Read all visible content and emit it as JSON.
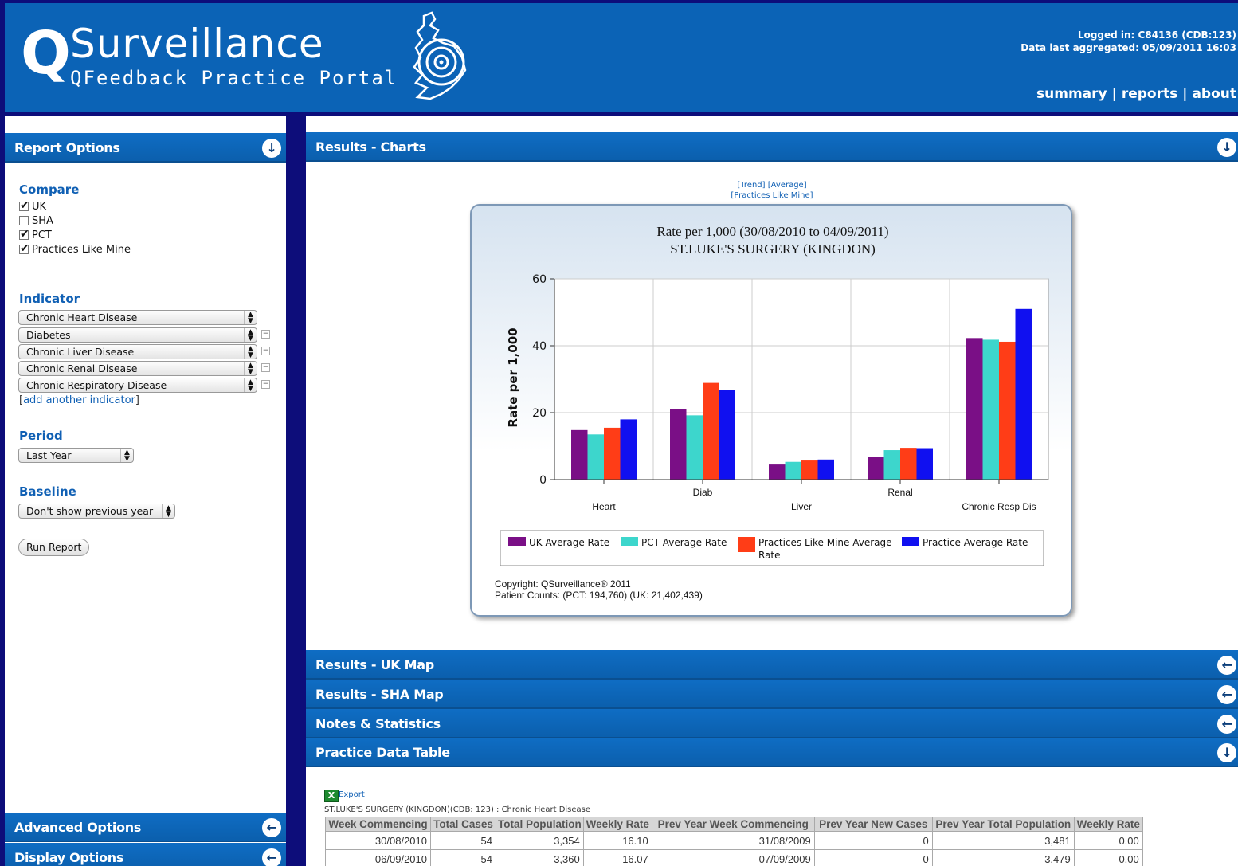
{
  "header": {
    "logo_q": "Q",
    "logo_main": "Surveillance",
    "logo_sub": "QFeedback Practice Portal",
    "logged_in": "Logged in: C84136 (CDB:123)",
    "data_aggregated": "Data last aggregated: 05/09/2011 16:03",
    "nav": {
      "summary": "summary",
      "reports": "reports",
      "about": "about",
      "separator": "|"
    }
  },
  "sidebar": {
    "report_options_title": "Report Options",
    "compare_heading": "Compare",
    "compare_items": [
      {
        "label": "UK",
        "checked": true
      },
      {
        "label": "SHA",
        "checked": false
      },
      {
        "label": "PCT",
        "checked": true
      },
      {
        "label": "Practices Like Mine",
        "checked": true
      }
    ],
    "indicator_heading": "Indicator",
    "indicators": [
      "Chronic Heart Disease",
      "Diabetes",
      "Chronic Liver Disease",
      "Chronic Renal Disease",
      "Chronic Respiratory Disease"
    ],
    "add_indicator_open": "[",
    "add_indicator_link": "add another indicator",
    "add_indicator_close": "]",
    "period_heading": "Period",
    "period_value": "Last Year",
    "baseline_heading": "Baseline",
    "baseline_value": "Don't show previous year",
    "run_report": "Run Report",
    "advanced_options": "Advanced Options",
    "display_options": "Display Options"
  },
  "main": {
    "results_charts": "Results - Charts",
    "chart_links": {
      "trend": "[Trend]",
      "average": "[Average]",
      "practices_like_mine": "[Practices Like Mine]"
    },
    "results_uk_map": "Results - UK Map",
    "results_sha_map": "Results - SHA Map",
    "notes_statistics": "Notes & Statistics",
    "practice_data_table": "Practice Data Table",
    "export_label": "Export",
    "table_caption": "ST.LUKE'S SURGERY (KINGDON)(CDB: 123) : Chronic Heart Disease",
    "table_headers": [
      "Week Commencing",
      "Total Cases",
      "Total Population",
      "Weekly Rate",
      "Prev Year Week Commencing",
      "Prev Year New Cases",
      "Prev Year Total Population",
      "Weekly Rate"
    ],
    "table_rows": [
      [
        "30/08/2010",
        "54",
        "3,354",
        "16.10",
        "31/08/2009",
        "0",
        "3,481",
        "0.00"
      ],
      [
        "06/09/2010",
        "54",
        "3,360",
        "16.07",
        "07/09/2009",
        "0",
        "3,479",
        "0.00"
      ]
    ]
  },
  "chart_data": {
    "type": "bar",
    "title": "Rate per 1,000 (30/08/2010 to 04/09/2011)",
    "subtitle": "ST.LUKE'S SURGERY (KINGDON)",
    "xlabel": "",
    "ylabel": "Rate per 1,000",
    "ylim": [
      0,
      60
    ],
    "yticks": [
      0,
      20,
      40,
      60
    ],
    "grid": true,
    "categories": [
      "Heart",
      "Diab",
      "Liver",
      "Renal",
      "Chronic Resp Dis"
    ],
    "series": [
      {
        "name": "UK Average Rate",
        "color": "#7a0f86",
        "values": [
          14.8,
          21.0,
          4.5,
          6.8,
          42.3
        ]
      },
      {
        "name": "PCT Average Rate",
        "color": "#3dd6cc",
        "values": [
          13.5,
          19.2,
          5.3,
          8.8,
          41.8
        ]
      },
      {
        "name": "Practices Like Mine Average Rate",
        "color": "#ff3d17",
        "values": [
          15.5,
          28.9,
          5.7,
          9.5,
          41.2
        ]
      },
      {
        "name": "Practice Average Rate",
        "color": "#1010f0",
        "values": [
          18.0,
          26.7,
          6.0,
          9.4,
          51.0
        ]
      }
    ],
    "legend_position": "bottom",
    "copyright": "Copyright: QSurveillance® 2011",
    "patient_counts": "Patient Counts: (PCT: 194,760) (UK: 21,402,439)"
  }
}
